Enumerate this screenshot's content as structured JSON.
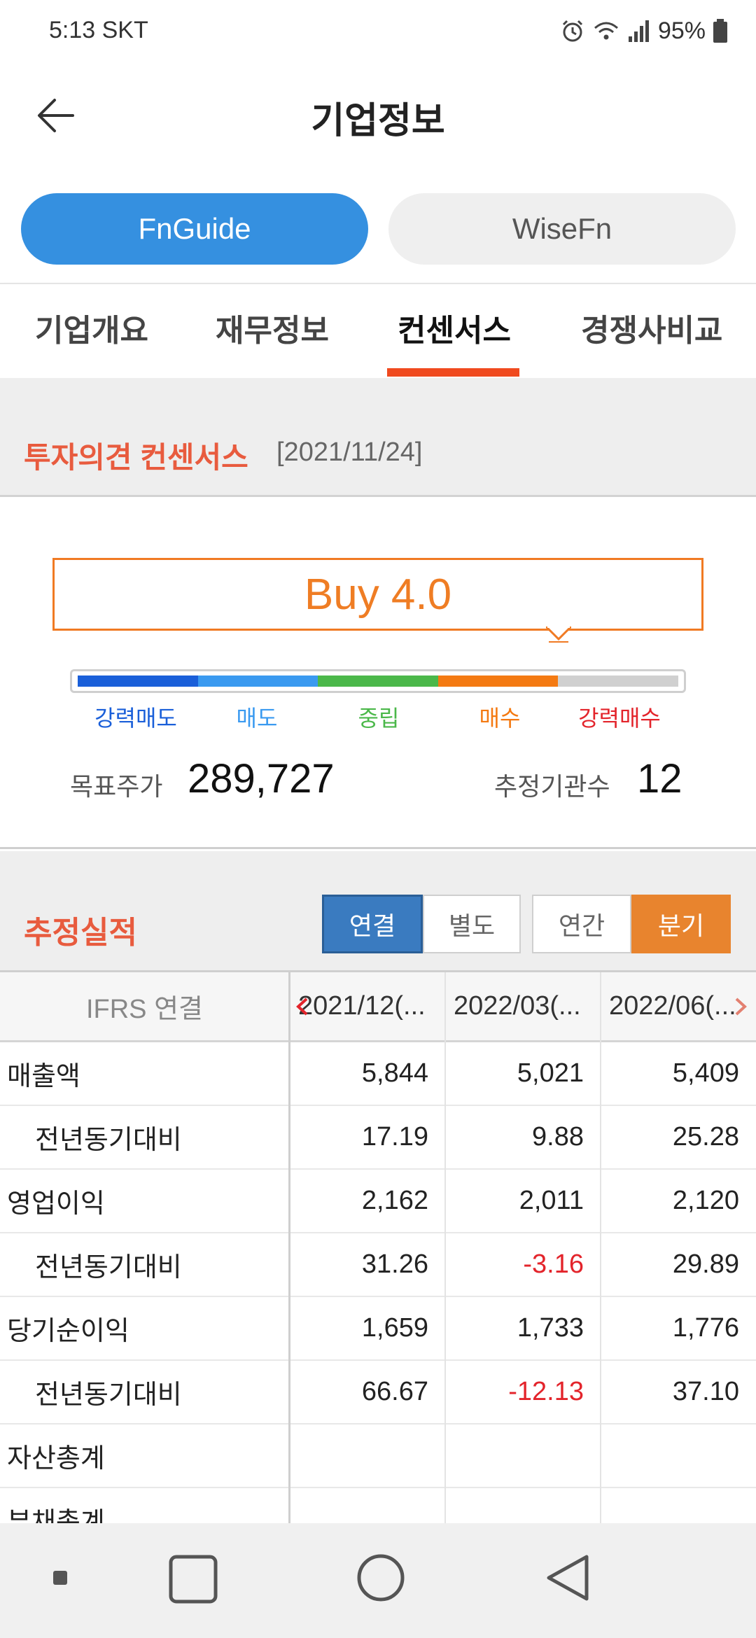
{
  "status_bar": {
    "time": "5:13 SKT",
    "battery": "95%"
  },
  "header": {
    "title": "기업정보"
  },
  "providers": [
    {
      "label": "FnGuide",
      "active": true
    },
    {
      "label": "WiseFn",
      "active": false
    }
  ],
  "tabs": [
    {
      "label": "기업개요"
    },
    {
      "label": "재무정보"
    },
    {
      "label": "컨센서스",
      "active": true
    },
    {
      "label": "경쟁사비교"
    }
  ],
  "consensus": {
    "title": "투자의견 컨센서스",
    "date": "[2021/11/24]",
    "rating": "Buy 4.0",
    "rating_value": 4.0,
    "scale": [
      {
        "label": "강력매도",
        "color": "#1a5fd9"
      },
      {
        "label": "매도",
        "color": "#3a9af0"
      },
      {
        "label": "중립",
        "color": "#4bb84a"
      },
      {
        "label": "매수",
        "color": "#f47a12"
      },
      {
        "label": "강력매수",
        "color": "#d0d0d0",
        "label_color": "#e3242b"
      }
    ],
    "target_price_label": "목표주가",
    "target_price": "289,727",
    "analysts_label": "추정기관수",
    "analysts": "12"
  },
  "estimates": {
    "title": "추정실적",
    "toggle1": [
      "연결",
      "별도"
    ],
    "toggle2": [
      "연간",
      "분기"
    ],
    "table": {
      "header": [
        "IFRS 연결",
        "2021/12(...",
        "2022/03(...",
        "2022/06(..."
      ],
      "rows": [
        {
          "label": "매출액",
          "sub": false,
          "values": [
            "5,844",
            "5,021",
            "5,409"
          ]
        },
        {
          "label": "전년동기대비",
          "sub": true,
          "values": [
            "17.19",
            "9.88",
            "25.28"
          ]
        },
        {
          "label": "영업이익",
          "sub": false,
          "values": [
            "2,162",
            "2,011",
            "2,120"
          ]
        },
        {
          "label": "전년동기대비",
          "sub": true,
          "values": [
            "31.26",
            "-3.16",
            "29.89"
          ]
        },
        {
          "label": "당기순이익",
          "sub": false,
          "values": [
            "1,659",
            "1,733",
            "1,776"
          ]
        },
        {
          "label": "전년동기대비",
          "sub": true,
          "values": [
            "66.67",
            "-12.13",
            "37.10"
          ]
        },
        {
          "label": "자산총계",
          "sub": false,
          "values": [
            "",
            "",
            ""
          ]
        },
        {
          "label": "부채총계",
          "sub": false,
          "values": [
            "",
            "",
            ""
          ]
        }
      ]
    }
  },
  "colors": {
    "accent_blue": "#3590e0",
    "accent_orange": "#ef7d24",
    "tab_indicator": "#f04a1f",
    "negative": "#e3242b"
  }
}
